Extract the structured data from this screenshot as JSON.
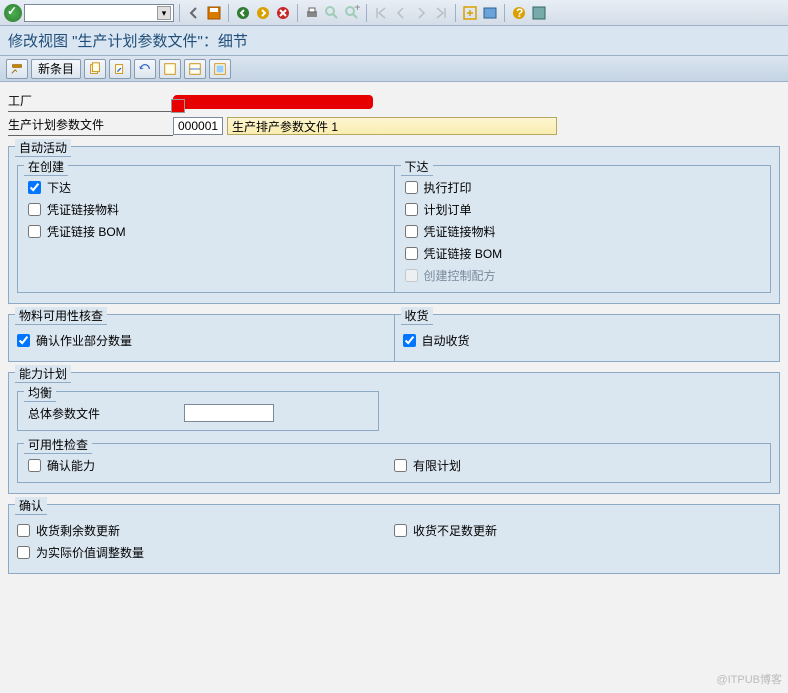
{
  "title": "修改视图 \"生产计划参数文件\"：细节",
  "app_toolbar": {
    "new_entry": "新条目"
  },
  "header_fields": {
    "plant_label": "工厂",
    "profile_label": "生产计划参数文件",
    "profile_code": "000001",
    "profile_desc": "生产排产参数文件 1"
  },
  "groups": {
    "auto_activity": {
      "title": "自动活动",
      "on_create": {
        "title": "在创建",
        "release": "下达",
        "doc_link_material": "凭证链接物料",
        "doc_link_bom": "凭证链接 BOM"
      },
      "release": {
        "title": "下达",
        "exec_print": "执行打印",
        "plan_order": "计划订单",
        "doc_link_material": "凭证链接物料",
        "doc_link_bom": "凭证链接 BOM",
        "create_ctrl_recipe": "创建控制配方"
      }
    },
    "material_avail": {
      "title": "物料可用性核查",
      "confirm_partial": "确认作业部分数量"
    },
    "goods_receipt": {
      "title": "收货",
      "auto_gr": "自动收货"
    },
    "capacity_plan": {
      "title": "能力计划",
      "balance": {
        "title": "均衡",
        "overall_profile": "总体参数文件"
      },
      "avail_check": {
        "title": "可用性检查",
        "confirm_capacity": "确认能力",
        "finite_plan": "有限计划"
      }
    },
    "confirm": {
      "title": "确认",
      "gr_remain_update": "收货剩余数更新",
      "gr_short_update": "收货不足数更新",
      "adj_actual_value": "为实际价值调整数量"
    }
  },
  "watermark": "@ITPUB博客"
}
